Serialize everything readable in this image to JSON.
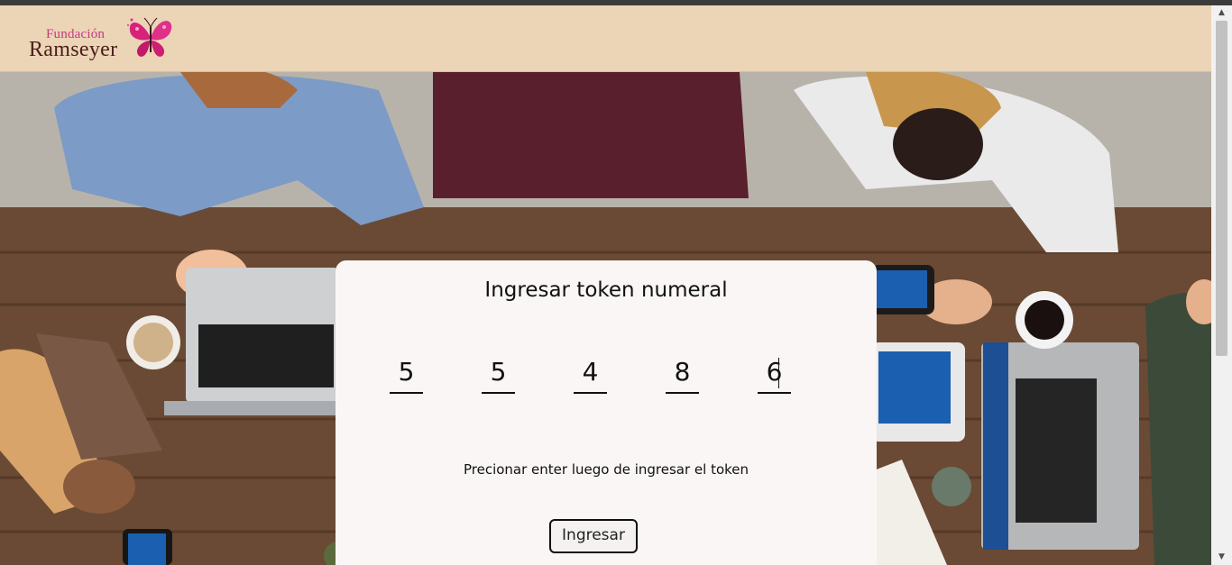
{
  "brand": {
    "line1": "Fundación",
    "line2": "Ramseyer",
    "logo_color_accent": "#c23a7c",
    "logo_color_text": "#4a1f1a"
  },
  "colors": {
    "navbar_bg": "#ecd4b6",
    "card_bg": "#f9f6f5"
  },
  "token_card": {
    "title": "Ingresar token numeral",
    "digits": [
      "5",
      "5",
      "4",
      "8",
      "6"
    ],
    "hint": "Precionar enter luego de ingresar el token",
    "submit_label": "Ingresar"
  },
  "scrollbar": {
    "up_arrow": "▲",
    "down_arrow": "▼"
  }
}
